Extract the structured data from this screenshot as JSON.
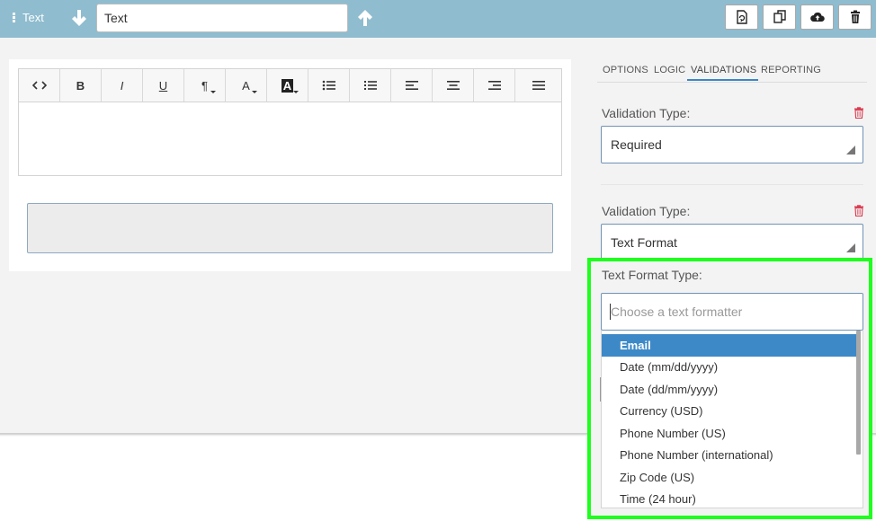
{
  "topbar": {
    "handle_label": "Text",
    "title_value": "Text",
    "icons": [
      "grip-icon",
      "arrow-down-icon",
      "arrow-up-icon",
      "refresh-doc-icon",
      "copy-icon",
      "cloud-upload-icon",
      "trash-icon"
    ]
  },
  "editor": {
    "toolbar": [
      {
        "name": "code-view",
        "glyph": "<>"
      },
      {
        "name": "bold",
        "glyph": "B"
      },
      {
        "name": "italic",
        "glyph": "I"
      },
      {
        "name": "underline",
        "glyph": "U"
      },
      {
        "name": "paragraph",
        "glyph": "¶"
      },
      {
        "name": "font-color",
        "glyph": "A"
      },
      {
        "name": "background-color",
        "glyph": "A"
      },
      {
        "name": "unordered-list",
        "glyph": "list"
      },
      {
        "name": "ordered-list",
        "glyph": "olist"
      },
      {
        "name": "align-left",
        "glyph": "left"
      },
      {
        "name": "align-center",
        "glyph": "center"
      },
      {
        "name": "align-right",
        "glyph": "right"
      },
      {
        "name": "justify",
        "glyph": "justify"
      }
    ]
  },
  "panel": {
    "tabs": [
      "OPTIONS",
      "LOGIC",
      "VALIDATIONS",
      "REPORTING"
    ],
    "active_tab": "VALIDATIONS",
    "validation1": {
      "label": "Validation Type:",
      "value": "Required"
    },
    "validation2": {
      "label": "Validation Type:",
      "value": "Text Format"
    },
    "text_format": {
      "label": "Text Format Type:",
      "placeholder": "Choose a text formatter",
      "options": [
        "Email",
        "Date (mm/dd/yyyy)",
        "Date (dd/mm/yyyy)",
        "Currency (USD)",
        "Phone Number (US)",
        "Phone Number (international)",
        "Zip Code (US)",
        "Time (24 hour)"
      ],
      "highlighted": "Email"
    }
  },
  "colors": {
    "topbar": "#8fbccf",
    "highlight_border": "#1dff1d",
    "option_active": "#3d89c8",
    "trash_red": "#d9364b"
  }
}
